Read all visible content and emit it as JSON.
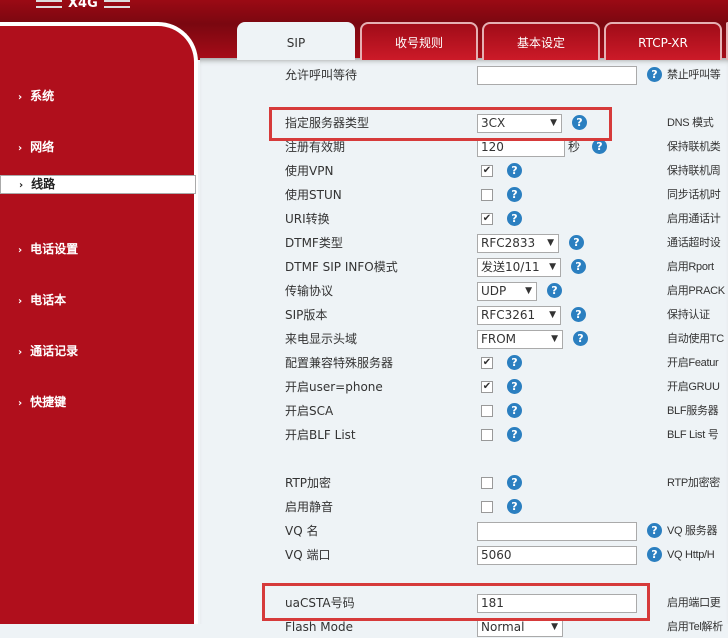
{
  "header": {
    "brand": "X4G"
  },
  "sidebar": {
    "items": [
      {
        "label": "系统"
      },
      {
        "label": "网络"
      },
      {
        "label": "线路",
        "selected": true
      },
      {
        "label": "电话设置"
      },
      {
        "label": "电话本"
      },
      {
        "label": "通话记录"
      },
      {
        "label": "快捷键"
      }
    ]
  },
  "tabs": [
    {
      "label": "SIP",
      "active": true
    },
    {
      "label": "收号规则"
    },
    {
      "label": "基本设定"
    },
    {
      "label": "RTCP-XR"
    }
  ],
  "rows": {
    "r0": {
      "label": "允许呼叫等待",
      "right": "禁止呼叫等"
    },
    "r1": {
      "label": "指定服务器类型",
      "value": "3CX",
      "right": "DNS 模式"
    },
    "r2": {
      "label": "注册有效期",
      "value": "120",
      "unit": "秒",
      "right": "保持联机类"
    },
    "r3": {
      "label": "使用VPN",
      "checked": true,
      "right": "保持联机周"
    },
    "r4": {
      "label": "使用STUN",
      "checked": false,
      "right": "同步话机时"
    },
    "r5": {
      "label": "URI转换",
      "checked": true,
      "right": "启用通话计"
    },
    "r6": {
      "label": "DTMF类型",
      "value": "RFC2833",
      "right": "通话超时设"
    },
    "r7": {
      "label": "DTMF SIP INFO模式",
      "value": "发送10/11",
      "right": "启用Rport"
    },
    "r8": {
      "label": "传输协议",
      "value": "UDP",
      "right": "启用PRACK"
    },
    "r9": {
      "label": "SIP版本",
      "value": "RFC3261",
      "right": "保持认证"
    },
    "r10": {
      "label": "来电显示头域",
      "value": "FROM",
      "right": "自动使用TC"
    },
    "r11": {
      "label": "配置兼容特殊服务器",
      "checked": true,
      "right": "开启Featur"
    },
    "r12": {
      "label": "开启user=phone",
      "checked": true,
      "right": "开启GRUU"
    },
    "r13": {
      "label": "开启SCA",
      "checked": false,
      "right": "BLF服务器"
    },
    "r14": {
      "label": "开启BLF List",
      "checked": false,
      "right": "BLF List 号"
    },
    "r15": {
      "label": "RTP加密",
      "checked": false,
      "right": "RTP加密密"
    },
    "r16": {
      "label": "启用静音",
      "checked": false
    },
    "r17": {
      "label": "VQ 名",
      "value": "",
      "right": "VQ 服务器"
    },
    "r18": {
      "label": "VQ 端口",
      "value": "5060",
      "right": "VQ Http/H"
    },
    "r19": {
      "label": "uaCSTA号码",
      "value": "181",
      "right": "启用端口更"
    },
    "r20": {
      "label": "Flash Mode",
      "value": "Normal",
      "right": "启用Tel解析"
    }
  },
  "colors": {
    "brand_red": "#b00f1c",
    "highlight": "#d63a3a",
    "help": "#2b7fc0"
  }
}
